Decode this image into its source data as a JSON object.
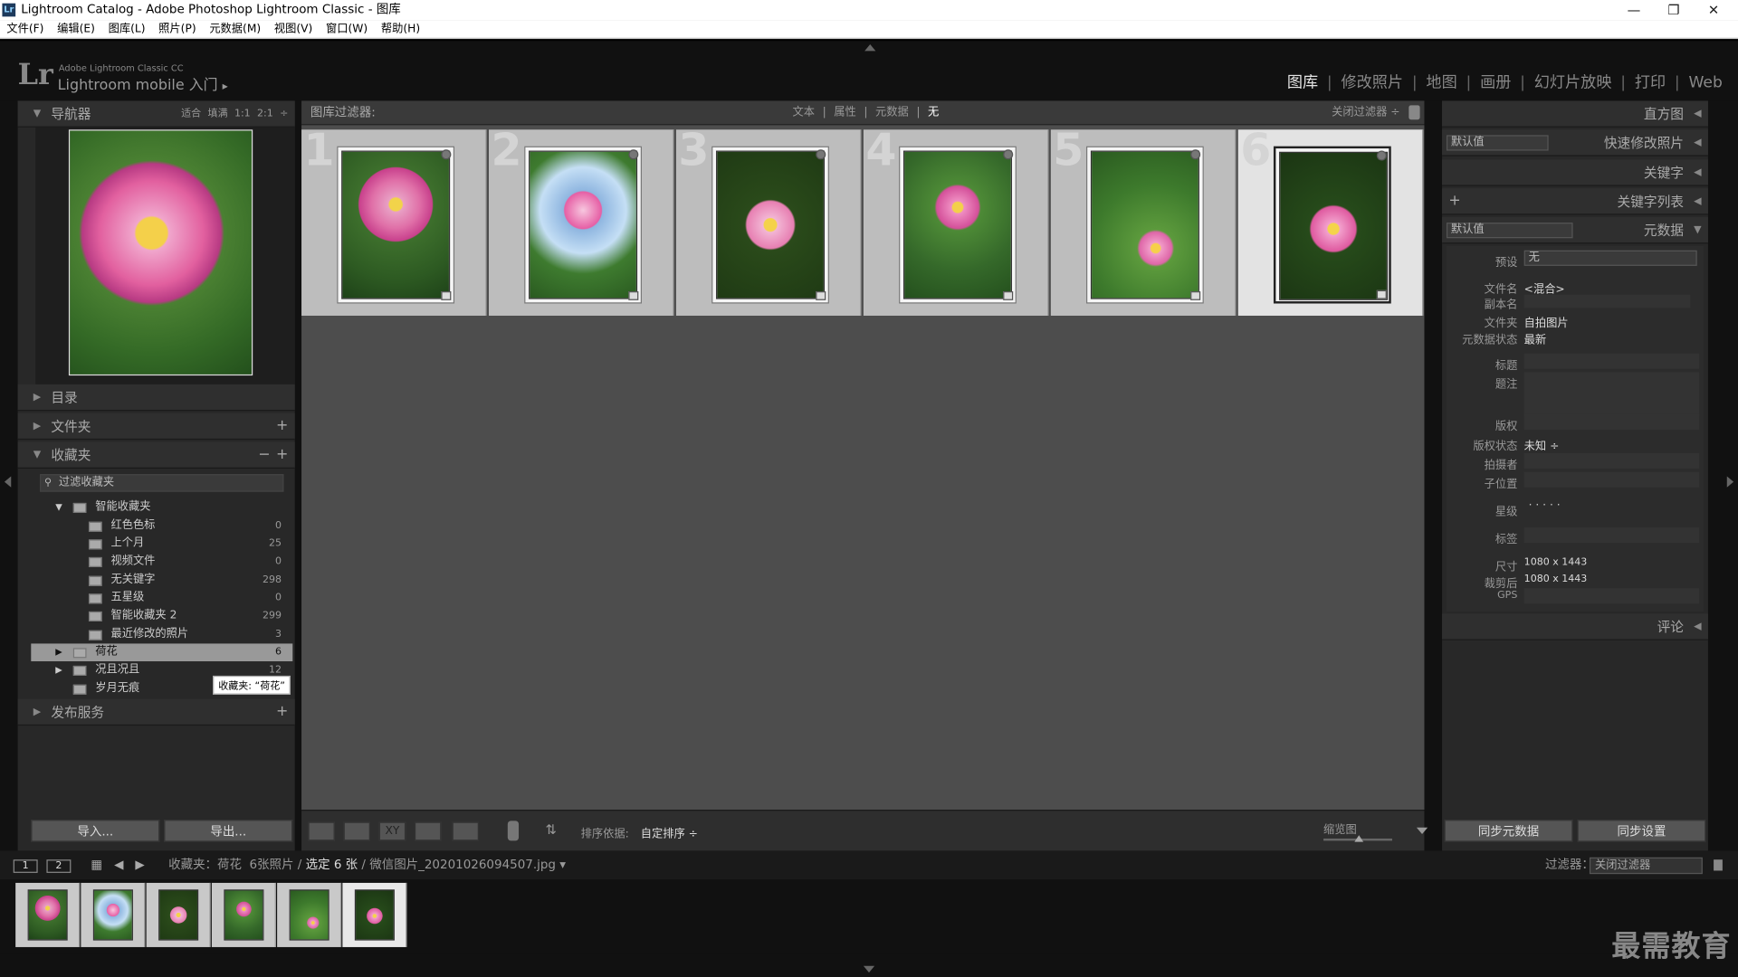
{
  "window": {
    "title": "Lightroom Catalog - Adobe Photoshop Lightroom Classic - 图库",
    "icon_text": "Lr"
  },
  "menu": [
    "文件(F)",
    "编辑(E)",
    "图库(L)",
    "照片(P)",
    "元数据(M)",
    "视图(V)",
    "窗口(W)",
    "帮助(H)"
  ],
  "identity": {
    "logo": "Lr",
    "small": "Adobe Lightroom Classic CC",
    "big": "Lightroom mobile 入门",
    "arrow": "▸"
  },
  "modules": [
    {
      "label": "图库",
      "active": true
    },
    {
      "label": "修改照片",
      "active": false
    },
    {
      "label": "地图",
      "active": false
    },
    {
      "label": "画册",
      "active": false
    },
    {
      "label": "幻灯片放映",
      "active": false
    },
    {
      "label": "打印",
      "active": false
    },
    {
      "label": "Web",
      "active": false
    }
  ],
  "navigator": {
    "title": "导航器",
    "options": [
      "适合",
      "填满",
      "1:1",
      "2:1"
    ]
  },
  "left_sections": {
    "catalog": "目录",
    "folders": "文件夹",
    "collections": "收藏夹",
    "publish": "发布服务"
  },
  "collections": {
    "filter_placeholder": "过滤收藏夹",
    "smart_set": "智能收藏夹",
    "smart_items": [
      {
        "name": "红色色标",
        "count": "0"
      },
      {
        "name": "上个月",
        "count": "25"
      },
      {
        "name": "视频文件",
        "count": "0"
      },
      {
        "name": "无关键字",
        "count": "298"
      },
      {
        "name": "五星级",
        "count": "0"
      },
      {
        "name": "智能收藏夹 2",
        "count": "299"
      },
      {
        "name": "最近修改的照片",
        "count": "3"
      }
    ],
    "items": [
      {
        "name": "荷花",
        "count": "6",
        "selected": true
      },
      {
        "name": "况且况且",
        "count": "12",
        "selected": false
      },
      {
        "name": "岁月无痕",
        "count": "",
        "selected": false
      }
    ],
    "tooltip": "收藏夹: “荷花”"
  },
  "left_buttons": {
    "import": "导入...",
    "export": "导出..."
  },
  "filter_bar": {
    "label": "图库过滤器:",
    "options": [
      "文本",
      "属性",
      "元数据",
      "无"
    ],
    "active": "无",
    "close": "关闭过滤器 ÷"
  },
  "grid": {
    "cells": [
      "1",
      "2",
      "3",
      "4",
      "5",
      "6"
    ],
    "selected": "6"
  },
  "toolbar": {
    "sort_label": "排序依据:",
    "sort_value": "自定排序 ÷",
    "zoom_label": "缩览图"
  },
  "right_panels": {
    "histogram": "直方图",
    "quick_develop": "快速修改照片",
    "quick_develop_preset": "默认值",
    "keywords": "关键字",
    "keyword_list": "关键字列表",
    "metadata": "元数据",
    "metadata_preset": "默认值",
    "comments": "评论"
  },
  "metadata": {
    "preset_label": "预设",
    "preset_value": "无",
    "filename_label": "文件名",
    "filename_value": "<混合>",
    "copyname_label": "副本名",
    "folder_label": "文件夹",
    "folder_value": "自拍图片",
    "status_label": "元数据状态",
    "status_value": "最新",
    "title_label": "标题",
    "caption_label": "题注",
    "copyright_label": "版权",
    "copyright_status_label": "版权状态",
    "copyright_status_value": "未知 ÷",
    "creator_label": "拍摄者",
    "sublocation_label": "子位置",
    "rating_label": "星级",
    "rating_value": "· · · · ·",
    "label_label": "标签",
    "size_label": "尺寸",
    "size_value": "1080 x 1443",
    "cropped_label": "裁剪后",
    "cropped_value": "1080 x 1443",
    "gps_label": "GPS"
  },
  "right_buttons": {
    "sync_metadata": "同步元数据",
    "sync_settings": "同步设置"
  },
  "filmstrip_bar": {
    "page1": "1",
    "page2": "2",
    "path_a": "收藏夹：荷花",
    "path_b": "6张照片 /",
    "path_c": "选定 6 张",
    "path_d": "/ 微信图片_20201026094507.jpg ▾",
    "filter_label": "过滤器：",
    "filter_value": "关闭过滤器"
  },
  "watermark": "最需教育"
}
